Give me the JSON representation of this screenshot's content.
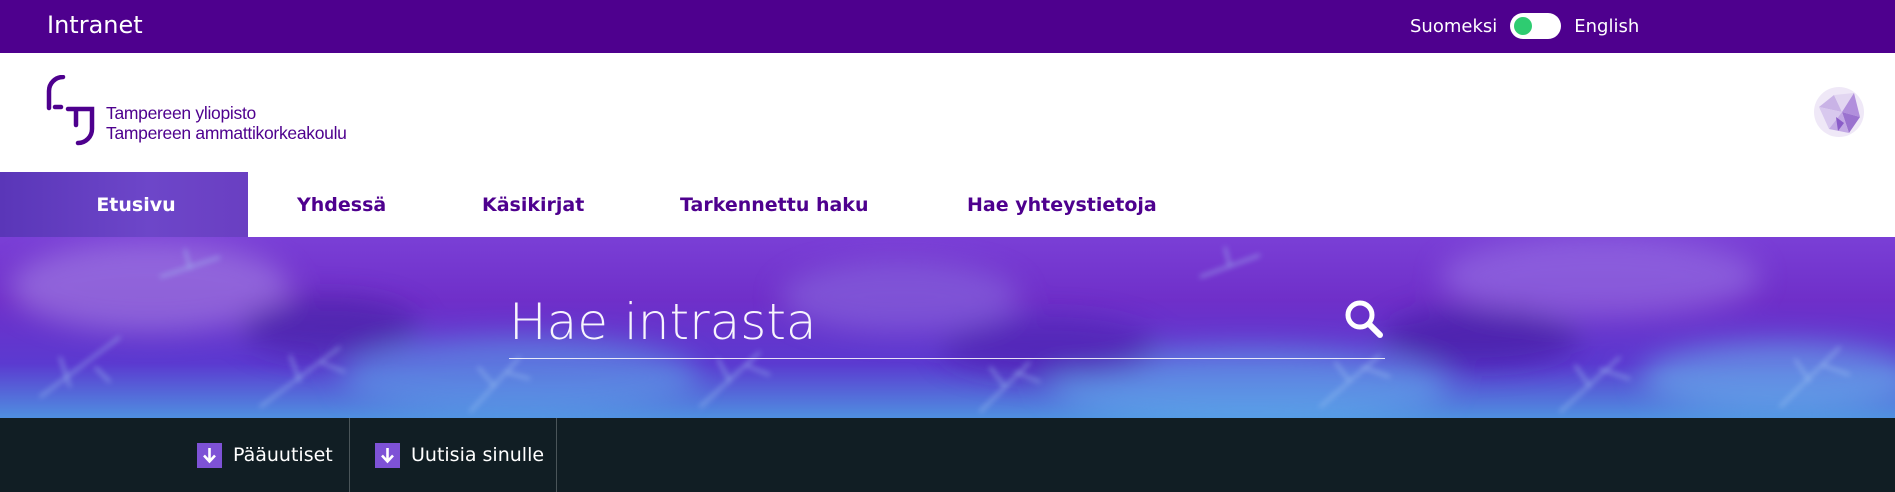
{
  "topbar": {
    "title": "Intranet",
    "lang_left": "Suomeksi",
    "lang_right": "English",
    "colors": {
      "background": "#4e008e",
      "toggle_on": "#2ecc71"
    }
  },
  "logo": {
    "line1": "Tampereen yliopisto",
    "line2": "Tampereen ammattikorkeakoulu"
  },
  "nav": {
    "tabs": [
      {
        "label": "Etusivu",
        "active": true
      },
      {
        "label": "Yhdessä",
        "active": false
      },
      {
        "label": "Käsikirjat",
        "active": false
      },
      {
        "label": "Tarkennettu haku",
        "active": false
      },
      {
        "label": "Hae yhteystietoja",
        "active": false
      }
    ]
  },
  "search": {
    "placeholder": "Hae intrasta",
    "icon": "search-icon"
  },
  "bottom": {
    "tabs": [
      {
        "label": "Pääuutiset",
        "icon": "arrow-down-icon"
      },
      {
        "label": "Uutisia sinulle",
        "icon": "arrow-down-icon"
      }
    ]
  }
}
